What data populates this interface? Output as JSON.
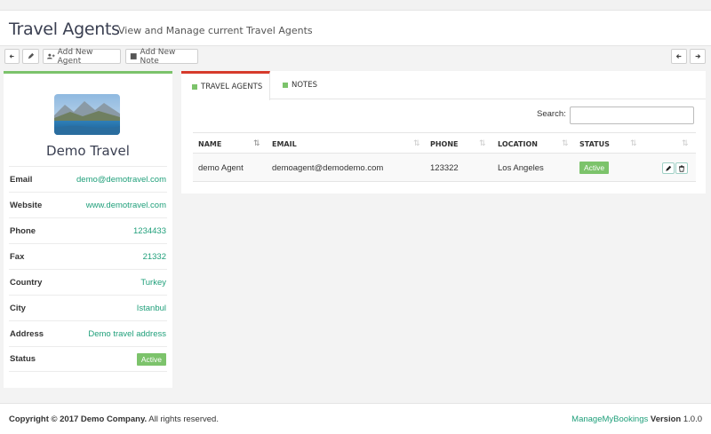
{
  "header": {
    "title": "Travel Agents",
    "subtitle": "View and Manage current Travel Agents"
  },
  "toolbar": {
    "add_agent_label": "Add New Agent",
    "add_note_label": "Add New Note"
  },
  "company": {
    "name": "Demo Travel",
    "fields": [
      {
        "label": "Email",
        "value": "demo@demotravel.com"
      },
      {
        "label": "Website",
        "value": "www.demotravel.com"
      },
      {
        "label": "Phone",
        "value": "1234433"
      },
      {
        "label": "Fax",
        "value": "21332"
      },
      {
        "label": "Country",
        "value": "Turkey"
      },
      {
        "label": "City",
        "value": "Istanbul"
      },
      {
        "label": "Address",
        "value": "Demo travel address"
      },
      {
        "label": "Status",
        "value": "Active"
      }
    ]
  },
  "tabs": [
    {
      "label": "TRAVEL AGENTS",
      "active": true
    },
    {
      "label": "NOTES",
      "active": false
    }
  ],
  "search": {
    "label": "Search:",
    "value": ""
  },
  "table": {
    "columns": [
      "NAME",
      "EMAIL",
      "PHONE",
      "LOCATION",
      "STATUS"
    ],
    "rows": [
      {
        "name": "demo Agent",
        "email": "demoagent@demodemo.com",
        "phone": "123322",
        "location": "Los Angeles",
        "status": "Active"
      }
    ]
  },
  "footer": {
    "copyright": "Copyright © 2017 Demo Company.",
    "rights": " All rights reserved.",
    "brand": "ManageMyBookings",
    "version_label": "Version",
    "version": "1.0.0"
  },
  "colors": {
    "accent": "#7cc36b",
    "tab_active": "#d63a2b",
    "link": "#1f9f7a"
  }
}
